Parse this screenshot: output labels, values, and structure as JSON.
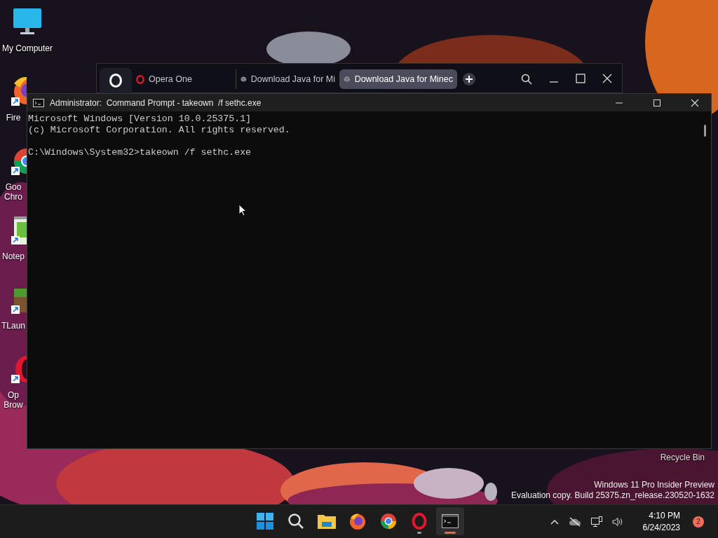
{
  "desktop_icons": [
    {
      "kind": "monitor",
      "lines": [
        "My Computer"
      ]
    },
    {
      "kind": "firefox",
      "lines": [
        "Fire"
      ]
    },
    {
      "kind": "chrome",
      "lines": [
        "Goo",
        "Chro"
      ]
    },
    {
      "kind": "notepad",
      "lines": [
        "Notep"
      ]
    },
    {
      "kind": "block",
      "lines": [
        "TLaun"
      ]
    },
    {
      "kind": "opera",
      "lines": [
        "Op",
        "Brow"
      ]
    }
  ],
  "recycle_bin": {
    "label": "Recycle Bin"
  },
  "edition_notice": [
    "Windows 11 Pro Insider Preview",
    "Evaluation copy. Build 25375.zn_release.230520-1632"
  ],
  "browser_window": {
    "tabs": [
      {
        "label": "Opera One",
        "kind": "opera",
        "selected": false
      },
      {
        "label": "Download Java for Mi",
        "kind": "cube",
        "selected": false
      },
      {
        "label": "Download Java for Minec",
        "kind": "cube",
        "selected": true
      }
    ]
  },
  "console_window": {
    "title": "Administrator:  Command Prompt - takeown  /f sethc.exe",
    "lines": [
      "Microsoft Windows [Version 10.0.25375.1]",
      "(c) Microsoft Corporation. All rights reserved."
    ],
    "prompt": "C:\\Windows\\System32>takeown /f sethc.exe"
  },
  "taskbar": {
    "apps": [
      {
        "kind": "start",
        "running": false,
        "selected": false
      },
      {
        "kind": "search",
        "running": false,
        "selected": false
      },
      {
        "kind": "folder",
        "running": false,
        "selected": false
      },
      {
        "kind": "firefox",
        "running": false,
        "selected": false
      },
      {
        "kind": "chrome",
        "running": false,
        "selected": false
      },
      {
        "kind": "opera",
        "running": true,
        "selected": false
      },
      {
        "kind": "terminal",
        "running": true,
        "selected": true
      }
    ],
    "time": "4:10 PM",
    "date": "6/24/2023",
    "notifications": "2"
  }
}
